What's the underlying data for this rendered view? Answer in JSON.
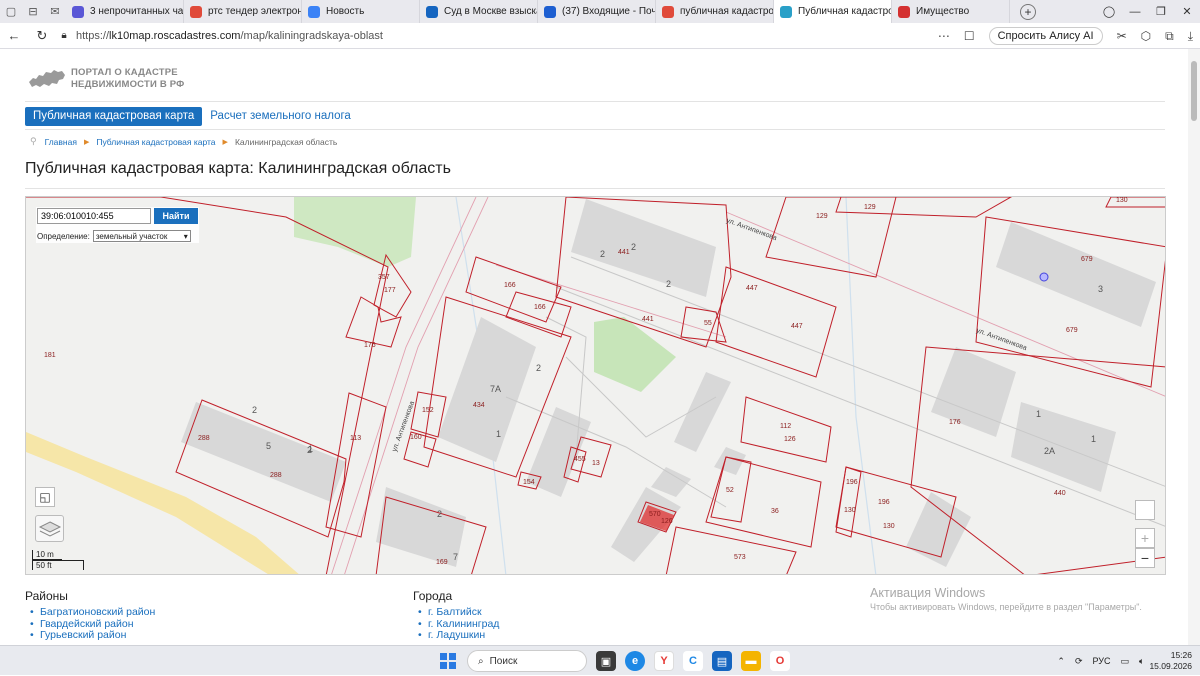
{
  "browser": {
    "tabs": [
      {
        "label": "3 непрочитанных чата",
        "color": "#5a57d6"
      },
      {
        "label": "ртс тендер электронна",
        "color": "#e04a3a"
      },
      {
        "label": "Новость",
        "color": "#3b82f6"
      },
      {
        "label": "Суд в Москве взыскал с",
        "color": "#1565c0"
      },
      {
        "label": "(37) Входящие - Почта М",
        "color": "#1e5fd1"
      },
      {
        "label": "публичная кадастровая",
        "color": "#e04a3a"
      },
      {
        "label": "Публичная кадастро",
        "color": "#2aa0c8",
        "active": true,
        "close": "×"
      },
      {
        "label": "Имущество",
        "color": "#d43131"
      }
    ],
    "url_prefix": "https://",
    "url_host": "lk10map.roscadastres.com",
    "url_path": "/map/kaliningradskaya-oblast",
    "alice_label": "Спросить Алису AI"
  },
  "site": {
    "logo_line1": "ПОРТАЛ О КАДАСТРЕ",
    "logo_line2": "НЕДВИЖИМОСТИ В РФ",
    "menu": [
      "Публичная кадастровая карта",
      "Расчет земельного налога"
    ],
    "breadcrumbs": [
      "Главная",
      "Публичная кадастровая карта",
      "Калининградская область"
    ],
    "title": "Публичная кадастровая карта: Калининградская область"
  },
  "map": {
    "search_value": "39:06:010010:455",
    "search_button": "Найти",
    "definition_label": "Определение:",
    "definition_value": "земельный участок",
    "scale_m": "10 m",
    "scale_ft": "50 ft",
    "zoom_in": "+",
    "zoom_out": "−",
    "streets": [
      "ул. Антипенкова",
      "ул. Антипенкова",
      "ул. Антипенкова"
    ],
    "parcel_labels": [
      "181",
      "177",
      "357",
      "176",
      "288",
      "288",
      "113",
      "152",
      "160",
      "434",
      "166",
      "166",
      "441",
      "441",
      "55",
      "447",
      "447",
      "129",
      "129",
      "679",
      "679",
      "176",
      "440",
      "112",
      "126",
      "52",
      "36",
      "196",
      "196",
      "130",
      "130",
      "573",
      "169",
      "455",
      "13",
      "154",
      "570",
      "130",
      "126",
      "2",
      "2",
      "2",
      "2",
      "2",
      "2",
      "1",
      "1",
      "1",
      "1",
      "3",
      "5",
      "7",
      "7А",
      "2А",
      "2"
    ]
  },
  "footer": {
    "districts_title": "Районы",
    "districts": [
      "Багратионовский район",
      "Гвардейский район",
      "Гурьевский район"
    ],
    "cities_title": "Города",
    "cities": [
      "г. Балтийск",
      "г. Калининград",
      "г. Ладушкин"
    ]
  },
  "watermark": {
    "line1": "Активация Windows",
    "line2": "Чтобы активировать Windows, перейдите в раздел \"Параметры\"."
  },
  "taskbar": {
    "search_label": "Поиск",
    "lang": "РУС",
    "time": "15:26",
    "date": "15.09.2026"
  }
}
